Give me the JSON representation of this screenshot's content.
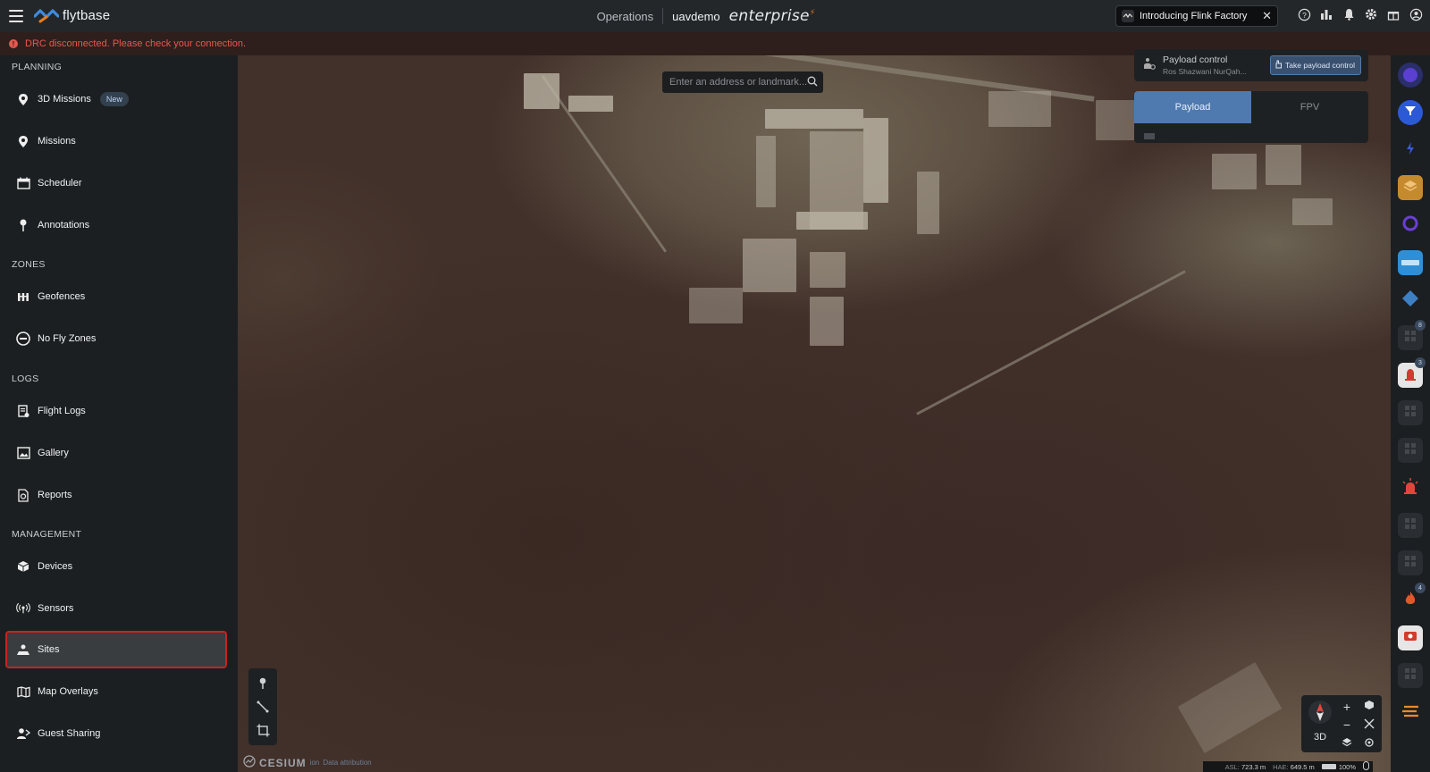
{
  "brand": {
    "name": "flytbase"
  },
  "header": {
    "section": "Operations",
    "org": "uavdemo",
    "edition": "enterprise",
    "announcement": "Introducing Flink Factory"
  },
  "alert": {
    "message": "DRC disconnected. Please check your connection."
  },
  "sidebar": {
    "sections": [
      {
        "title": "PLANNING",
        "items": [
          {
            "label": "3D Missions",
            "badge": "New",
            "icon": "pin-icon"
          },
          {
            "label": "Missions",
            "icon": "pin-icon"
          },
          {
            "label": "Scheduler",
            "icon": "calendar-icon"
          },
          {
            "label": "Annotations",
            "icon": "marker-icon"
          }
        ]
      },
      {
        "title": "ZONES",
        "items": [
          {
            "label": "Geofences",
            "icon": "fence-icon"
          },
          {
            "label": "No Fly Zones",
            "icon": "no-entry-icon"
          }
        ]
      },
      {
        "title": "LOGS",
        "items": [
          {
            "label": "Flight Logs",
            "icon": "log-icon"
          },
          {
            "label": "Gallery",
            "icon": "image-icon"
          },
          {
            "label": "Reports",
            "icon": "report-icon"
          }
        ]
      },
      {
        "title": "MANAGEMENT",
        "items": [
          {
            "label": "Devices",
            "icon": "cube-icon"
          },
          {
            "label": "Sensors",
            "icon": "broadcast-icon"
          },
          {
            "label": "Sites",
            "icon": "site-icon",
            "active": true
          },
          {
            "label": "Map Overlays",
            "icon": "map-icon"
          },
          {
            "label": "Guest Sharing",
            "icon": "share-user-icon"
          }
        ]
      }
    ]
  },
  "map": {
    "search_placeholder": "Enter an address or landmark...",
    "payload_control": {
      "title": "Payload control",
      "holder": "Ros Shazwani NurQah...",
      "action": "Take payload control"
    },
    "tabs": [
      "Payload",
      "FPV"
    ],
    "active_tab": "Payload",
    "attribution": {
      "brand": "CESIUM",
      "sub": "ion",
      "note": "Data attribution"
    },
    "view_mode": "3D",
    "status": {
      "asl_label": "ASL:",
      "asl": "723.3 m",
      "hae_label": "HAE:",
      "hae": "649.5 m",
      "battery": "100%"
    }
  },
  "rail": {
    "badges": {
      "item9": "8",
      "item10": "3",
      "item16": "4"
    }
  },
  "colors": {
    "accent": "#4f7ab0",
    "alert": "#e5584e",
    "active_outline": "#c8231d"
  }
}
